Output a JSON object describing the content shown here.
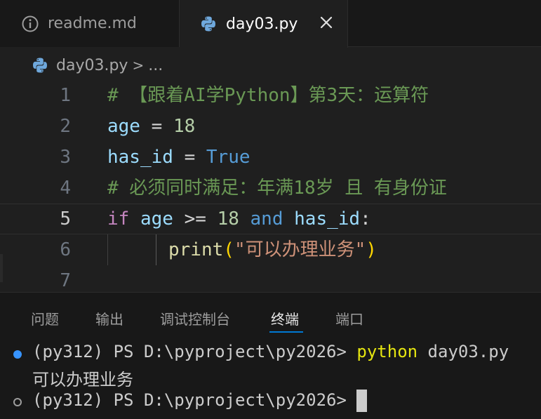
{
  "tabs": [
    {
      "label": "readme.md",
      "icon": "info-icon",
      "active": false
    },
    {
      "label": "day03.py",
      "icon": "python-icon",
      "active": true,
      "close_icon": "close-icon"
    }
  ],
  "breadcrumb": {
    "file": "day03.py",
    "separator": ">",
    "more": "..."
  },
  "editor": {
    "line_numbers": [
      "1",
      "2",
      "3",
      "4",
      "5",
      "6",
      "7"
    ],
    "current_line": "5",
    "lines": {
      "l1": {
        "comment": "# 【跟着AI学Python】第3天：运算符"
      },
      "l2": {
        "var": "age",
        "op": " = ",
        "num": "18"
      },
      "l3": {
        "var": "has_id",
        "op": " = ",
        "const": "True"
      },
      "l4": {
        "comment": "# 必须同时满足：年满18岁 且 有身份证"
      },
      "l5": {
        "kw_if": "if",
        "var1": "age",
        "op": " >= ",
        "num": "18",
        "kw_and": "and",
        "var2": "has_id",
        "colon": ":"
      },
      "l6": {
        "func": "print",
        "lparen": "(",
        "str": "\"可以办理业务\"",
        "rparen": ")"
      }
    }
  },
  "panel": {
    "tabs": [
      "问题",
      "输出",
      "调试控制台",
      "终端",
      "端口"
    ],
    "active_tab": "终端"
  },
  "terminal": {
    "line1_prompt": "(py312) PS D:\\pyproject\\py2026>",
    "line1_cmd": "python",
    "line1_arg": " day03.py",
    "line2_output": "可以办理业务",
    "line3_prompt": "(py312) PS D:\\pyproject\\py2026>"
  },
  "colors": {
    "accent": "#0078d4",
    "comment": "#6a9955",
    "variable": "#9cdcfe",
    "keyword": "#569cd6",
    "control_keyword": "#c586c0",
    "string": "#ce9178",
    "function": "#dcdcaa",
    "number": "#b5cea8"
  }
}
